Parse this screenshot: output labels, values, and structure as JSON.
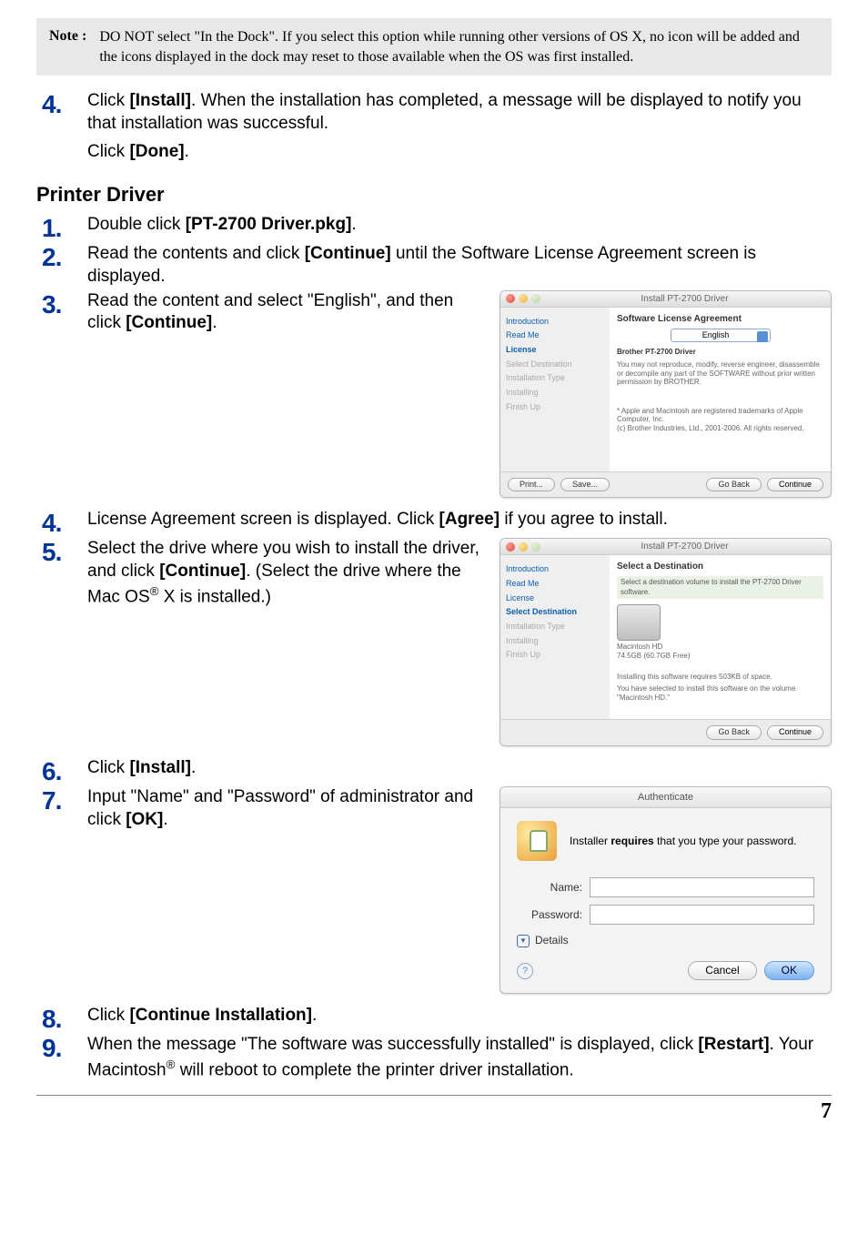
{
  "note": {
    "label": "Note :",
    "text": "DO NOT select \"In the Dock\". If you select this option while running other versions of OS X, no icon will be added and the icons displayed in the dock may reset to those available when the OS was first installed."
  },
  "preStep4": {
    "num": "4.",
    "p1a": "Click ",
    "p1b": "[Install]",
    "p1c": ". When the installation has completed, a message will be displayed to notify you that installation was successful.",
    "p2a": "Click ",
    "p2b": "[Done]",
    "p2c": "."
  },
  "sectionTitle": "Printer Driver",
  "s1": {
    "num": "1.",
    "a": "Double click ",
    "b": "[PT-2700 Driver.pkg]",
    "c": "."
  },
  "s2": {
    "num": "2.",
    "a": "Read the contents and click ",
    "b": "[Continue]",
    "c": " until the Software License Agreement screen is displayed."
  },
  "s3": {
    "num": "3.",
    "a": "Read the content and select \"English\", and then click ",
    "b": "[Continue]",
    "c": "."
  },
  "s4": {
    "num": "4.",
    "a": "License Agreement screen is displayed. Click ",
    "b": "[Agree]",
    "c": " if you agree to install."
  },
  "s5": {
    "num": "5.",
    "a": "Select the drive where you wish to install the driver, and click ",
    "b": "[Continue]",
    "c": ". (Select the drive where the Mac OS",
    "sup": "®",
    "d": " X is installed.)"
  },
  "s6": {
    "num": "6.",
    "a": "Click ",
    "b": "[Install]",
    "c": "."
  },
  "s7": {
    "num": "7.",
    "a": "Input \"Name\" and \"Password\" of administrator and click ",
    "b": "[OK]",
    "c": "."
  },
  "s8": {
    "num": "8.",
    "a": "Click ",
    "b": "[Continue Installation]",
    "c": "."
  },
  "s9": {
    "num": "9.",
    "a": "When the message \"The software was successfully installed\" is displayed, click ",
    "b": "[Restart]",
    "c": ". Your Macintosh",
    "sup": "®",
    "d": " will reboot to complete the printer driver installation."
  },
  "dlg1": {
    "title": "Install PT-2700 Driver",
    "heading": "Software License Agreement",
    "lang": "English",
    "line1": "Brother PT-2700 Driver",
    "para1": "You may not reproduce, modify, reverse engineer, disassemble or decompile any part of the SOFTWARE without prior written permission by BROTHER.",
    "para2": "* Apple and Macintosh are registered trademarks of Apple Computer, Inc.\n(c) Brother Industries, Ltd., 2001-2006. All rights reserved.",
    "side": {
      "intro": "Introduction",
      "read": "Read Me",
      "license": "License",
      "seldest": "Select Destination",
      "itype": "Installation Type",
      "inst": "Installing",
      "fin": "Finish Up"
    },
    "btnPrint": "Print...",
    "btnSave": "Save...",
    "btnBack": "Go Back",
    "btnCont": "Continue"
  },
  "dlg2": {
    "title": "Install PT-2700 Driver",
    "heading": "Select a Destination",
    "subhead": "Select a destination volume to install the PT-2700 Driver software.",
    "volName": "Macintosh HD",
    "volFree": "74.5GB (60.7GB Free)",
    "reqText": "Installing this software requires 503KB of space.",
    "selText": "You have selected to install this software on the volume \"Macintosh HD.\"",
    "side": {
      "intro": "Introduction",
      "read": "Read Me",
      "license": "License",
      "seldest": "Select Destination",
      "itype": "Installation Type",
      "inst": "Installing",
      "fin": "Finish Up"
    },
    "btnBack": "Go Back",
    "btnCont": "Continue"
  },
  "auth": {
    "title": "Authenticate",
    "message": "Installer requires that you type your password.",
    "nameLabel": "Name:",
    "passLabel": "Password:",
    "details": "Details",
    "cancel": "Cancel",
    "ok": "OK"
  },
  "pageNumber": "7"
}
